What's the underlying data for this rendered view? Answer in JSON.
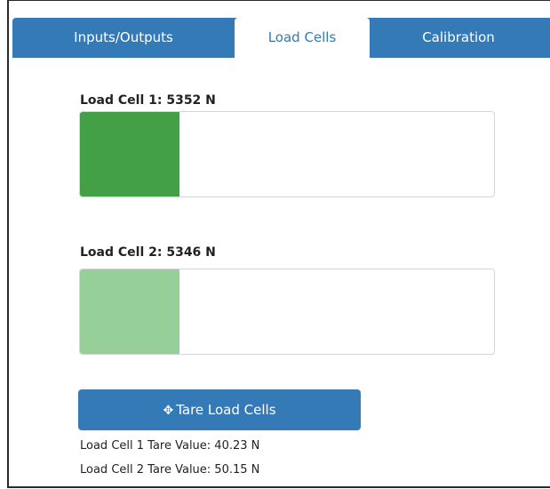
{
  "tabs": {
    "items": [
      {
        "label": "Inputs/Outputs"
      },
      {
        "label": "Load Cells"
      },
      {
        "label": "Calibration"
      }
    ],
    "active": "Load Cells"
  },
  "load_cells": [
    {
      "label": "Load Cell 1: 5352 N",
      "fill_fraction": 0.24,
      "color": "#43a047"
    },
    {
      "label": "Load Cell 2: 5346 N",
      "fill_fraction": 0.24,
      "color": "#96cf98"
    }
  ],
  "tare_button": {
    "label": "Tare Load Cells",
    "icon": "move-arrows-icon"
  },
  "tare_values": [
    "Load Cell 1 Tare Value: 40.23 N",
    "Load Cell 2 Tare Value: 50.15 N"
  ],
  "colors": {
    "accent": "#337ab7",
    "tab_text_inactive": "#ffffff",
    "tab_text_active": "#337ab7"
  }
}
